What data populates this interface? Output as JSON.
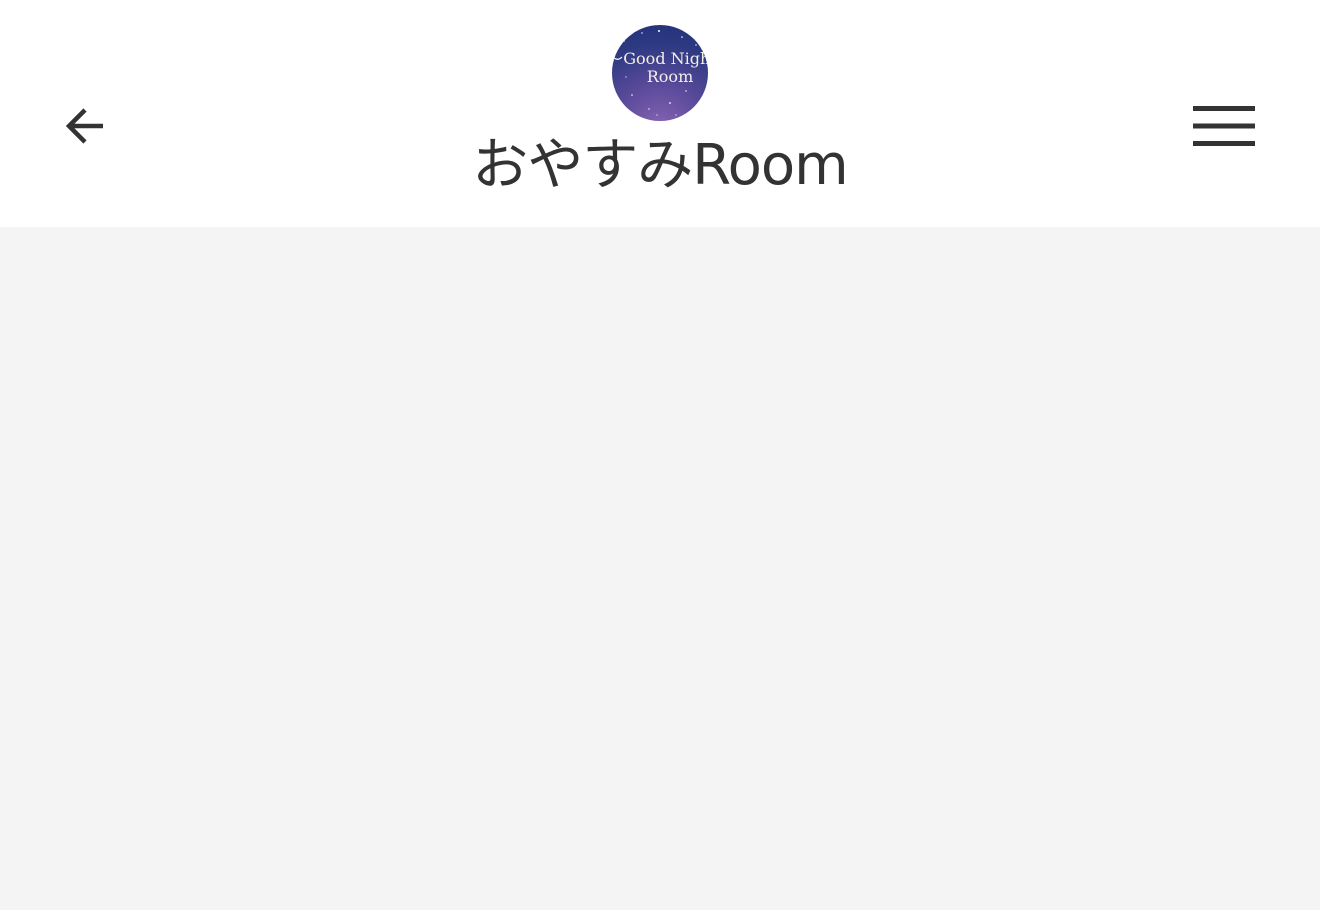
{
  "header": {
    "title": "おやすみRoom",
    "back_icon": "arrow-left-icon",
    "menu_icon": "hamburger-menu-icon"
  },
  "avatar": {
    "line1": "Good Night",
    "line2": "Room"
  },
  "colors": {
    "header_bg": "#ffffff",
    "page_bg": "#f4f4f4",
    "icon": "#333333",
    "text": "#333333"
  }
}
